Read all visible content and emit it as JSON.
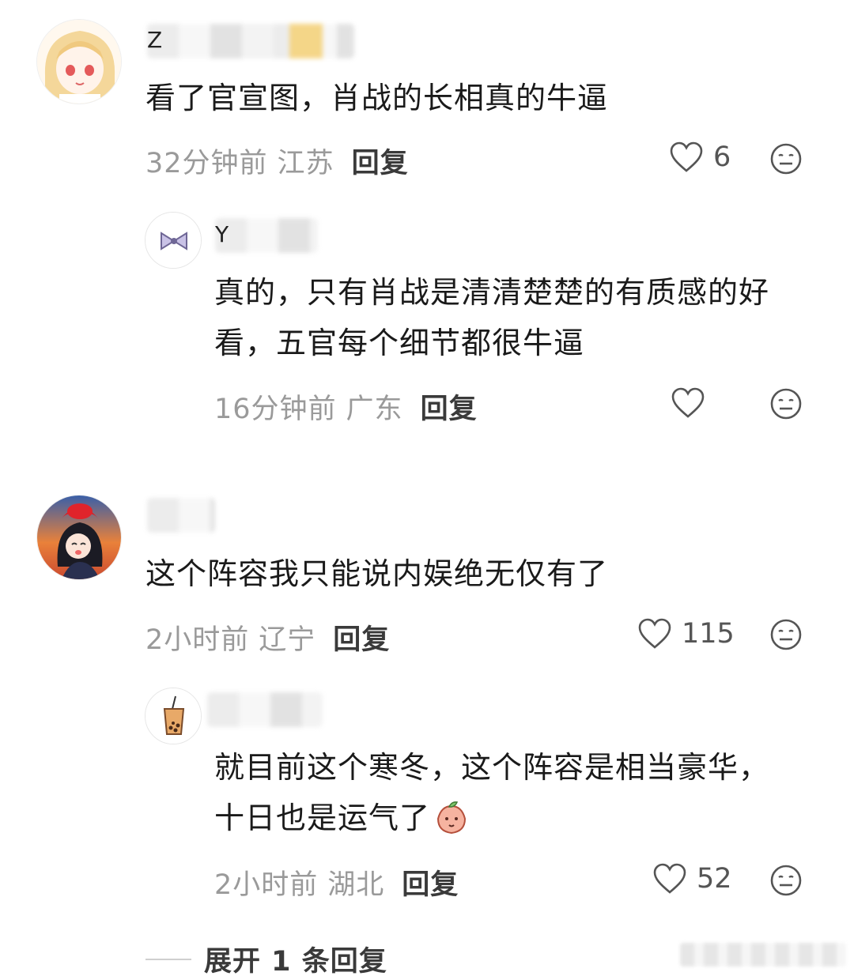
{
  "comments": [
    {
      "username_partial": "Z",
      "text": "看了官宣图，肖战的长相真的牛逼",
      "time": "32分钟前",
      "location": "江苏",
      "reply_label": "回复",
      "likes": "6",
      "replies": [
        {
          "username_partial": "Y",
          "text_line1": "真的，只有肖战是清清楚楚的有质感的好",
          "text_line2": "看，五官每个细节都很牛逼",
          "time": "16分钟前",
          "location": "广东",
          "reply_label": "回复",
          "likes": ""
        }
      ]
    },
    {
      "username_partial": "",
      "text": "这个阵容我只能说内娱绝无仅有了",
      "time": "2小时前",
      "location": "辽宁",
      "reply_label": "回复",
      "likes": "115",
      "replies": [
        {
          "username_partial": "",
          "text_line1": "就目前这个寒冬，这个阵容是相当豪华，",
          "text_line2": "十日也是运气了",
          "time": "2小时前",
          "location": "湖北",
          "reply_label": "回复",
          "likes": "52"
        }
      ]
    }
  ],
  "expand_label": "展开 1 条回复",
  "icons": {
    "like": "heart-outline-icon",
    "reaction": "neutral-face-icon",
    "emoji": "peach-emoji"
  },
  "colors": {
    "meta_gray": "#9a9a9a",
    "text": "#1a1a1a",
    "reply_label": "#3a3a3a"
  }
}
